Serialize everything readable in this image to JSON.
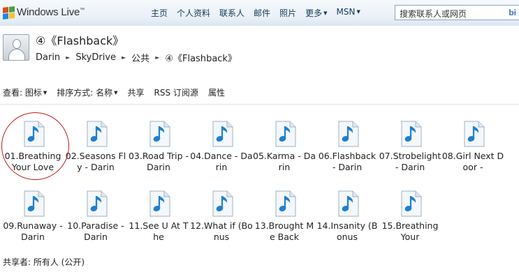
{
  "header": {
    "brand": "Windows Live",
    "brand_tm": "™",
    "nav": [
      {
        "label": "主页",
        "dropdown": false
      },
      {
        "label": "个人资料",
        "dropdown": false
      },
      {
        "label": "联系人",
        "dropdown": false
      },
      {
        "label": "邮件",
        "dropdown": false
      },
      {
        "label": "照片",
        "dropdown": false
      },
      {
        "label": "更多",
        "dropdown": true
      },
      {
        "label": "MSN",
        "dropdown": true
      }
    ],
    "search_placeholder": "搜索联系人或网页",
    "search_engine": "bi"
  },
  "folder": {
    "title": "④《Flashback》",
    "breadcrumb": [
      "Darin",
      "SkyDrive",
      "公共",
      "④《Flashback》"
    ]
  },
  "toolbar": {
    "view_label": "查看: ",
    "view_value": "图标",
    "sort_label": "排序方式: ",
    "sort_value": "名称",
    "share": "共享",
    "rss": "RSS 订阅源",
    "properties": "属性"
  },
  "files": [
    {
      "name": "01.Breathing Your Love"
    },
    {
      "name": "02.Seasons Fly - Darin"
    },
    {
      "name": "03.Road Trip - Darin"
    },
    {
      "name": "04.Dance - Darin"
    },
    {
      "name": "05.Karma - Darin"
    },
    {
      "name": "06.Flashback - Darin"
    },
    {
      "name": "07.Strobelight - Darin"
    },
    {
      "name": "08.Girl Next Door -"
    },
    {
      "name": "09.Runaway - Darin"
    },
    {
      "name": "10.Paradise - Darin"
    },
    {
      "name": "11.See U At The"
    },
    {
      "name": "12.What if (Bonus"
    },
    {
      "name": "13.Brought Me Back"
    },
    {
      "name": "14.Insanity (Bonus"
    },
    {
      "name": "15.Breathing Your"
    }
  ],
  "footer": {
    "shared_with": "共享者: 所有人 (公开)"
  },
  "colors": {
    "accent": "#15395b",
    "highlight_circle": "#c41a1a",
    "note_blue": "#1e7fd0"
  }
}
